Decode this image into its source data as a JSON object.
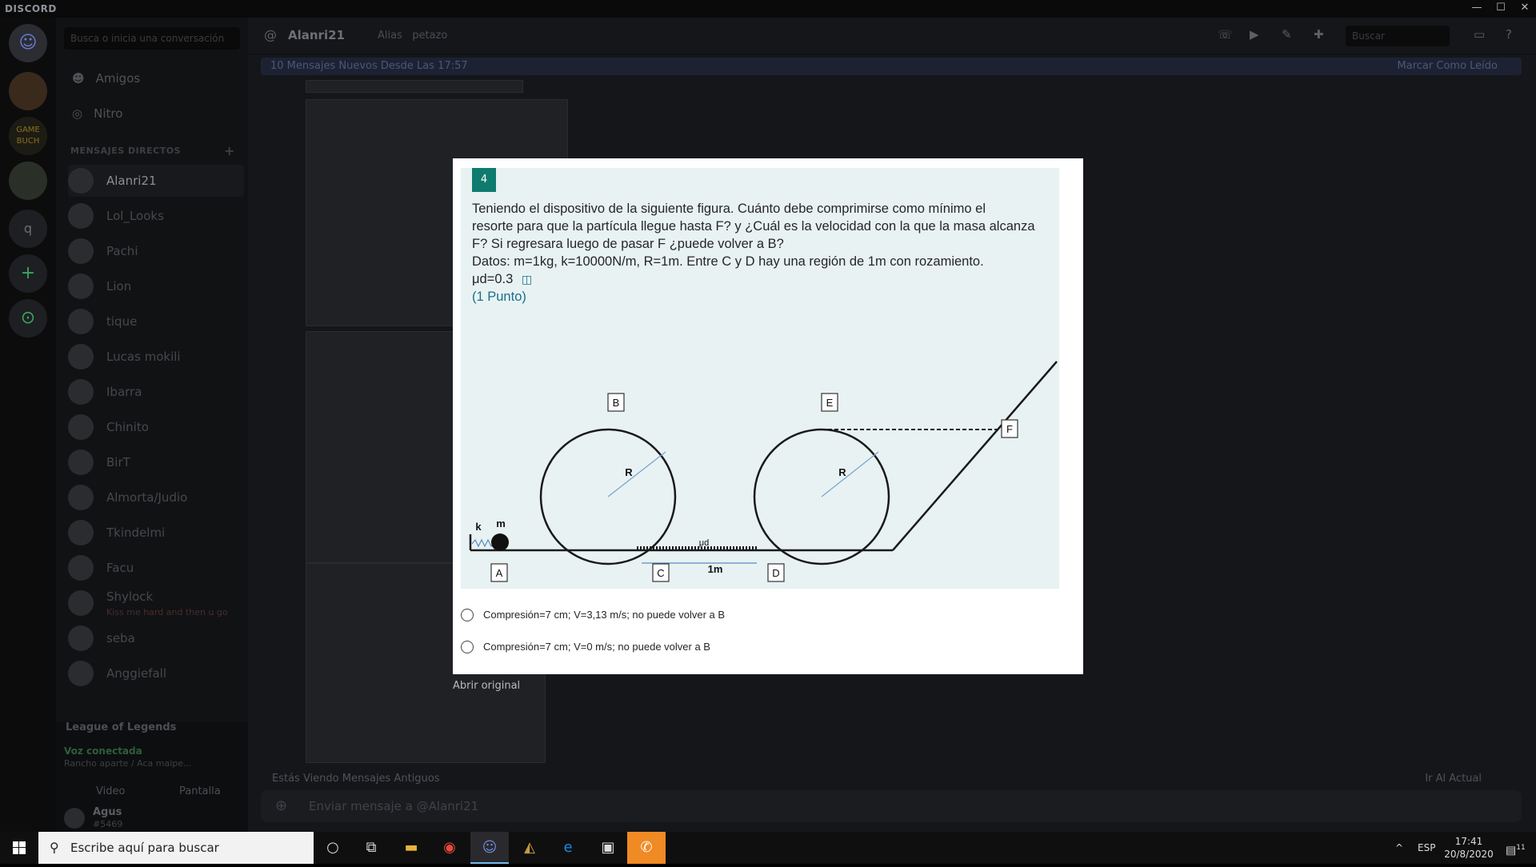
{
  "window": {
    "brand": "DISCORD",
    "minimize": "—",
    "maximize": "☐",
    "close": "✕"
  },
  "guilds": {
    "home_icon": "discord-logo",
    "add": "+",
    "explore": "⊙",
    "q_label": "q",
    "game_label": "GAME BUCH"
  },
  "dm": {
    "search_placeholder": "Busca o inicia una conversación",
    "friends": "Amigos",
    "nitro": "Nitro",
    "section_title": "MENSAJES DIRECTOS",
    "section_add": "+",
    "contacts": [
      {
        "name": "Alanri21"
      },
      {
        "name": "Lol_Looks"
      },
      {
        "name": "Pachi"
      },
      {
        "name": "Lion"
      },
      {
        "name": "tique"
      },
      {
        "name": "Lucas mokili"
      },
      {
        "name": "Ibarra"
      },
      {
        "name": "Chinito"
      },
      {
        "name": "BirT"
      },
      {
        "name": "Almorta/Judio"
      },
      {
        "name": "Tkindelmi"
      },
      {
        "name": "Facu"
      },
      {
        "name": "Shylock",
        "status": "Kiss me hard and then u go"
      },
      {
        "name": "seba"
      },
      {
        "name": "Anggiefall"
      }
    ],
    "game_activity": "League of Legends",
    "voice_status": "Voz conectada",
    "voice_channel": "Rancho aparte / Aca maipe...",
    "video": "Video",
    "screen": "Pantalla",
    "user_name": "Agus",
    "user_tag": "#5469"
  },
  "header": {
    "channel_name": "Alanri21",
    "alias_label": "Alias",
    "alias_value": "petazo",
    "search_placeholder": "Buscar"
  },
  "new_messages": {
    "text": "10 Mensajes Nuevos Desde Las 17:57",
    "mark_read": "Marcar Como Leído"
  },
  "old_messages": {
    "text": "Estás Viendo Mensajes Antiguos",
    "jump": "Ir Al Actual"
  },
  "composer": {
    "placeholder": "Enviar mensaje a @Alanri21"
  },
  "modal": {
    "question_number": "4",
    "question_lines": [
      "Teniendo el dispositivo de la siguiente figura. Cuánto debe comprimirse como mínimo el",
      "resorte para que la partícula llegue hasta F? y ¿Cuál es la velocidad con la que la masa alcanza",
      "F? Si regresara luego de pasar F ¿puede volver a B?",
      "Datos: m=1kg, k=10000N/m, R=1m. Entre C y D hay una región de 1m con rozamiento.",
      "μd=0.3"
    ],
    "points": "(1 Punto)",
    "diagram": {
      "labels": {
        "A": "A",
        "B": "B",
        "C": "C",
        "D": "D",
        "E": "E",
        "F": "F",
        "R1": "R",
        "R2": "R",
        "k": "k",
        "m": "m",
        "mu": "μd",
        "dist": "1m"
      }
    },
    "options": [
      "Compresión=7 cm; V=3,13 m/s; no puede volver a B",
      "Compresión=7 cm; V=0 m/s; no puede volver a B"
    ],
    "open_original": "Abrir original"
  },
  "taskbar": {
    "search_placeholder": "Escribe aquí para buscar",
    "lang": "ESP",
    "time": "17:41",
    "date": "20/8/2020",
    "notifications": "11"
  }
}
